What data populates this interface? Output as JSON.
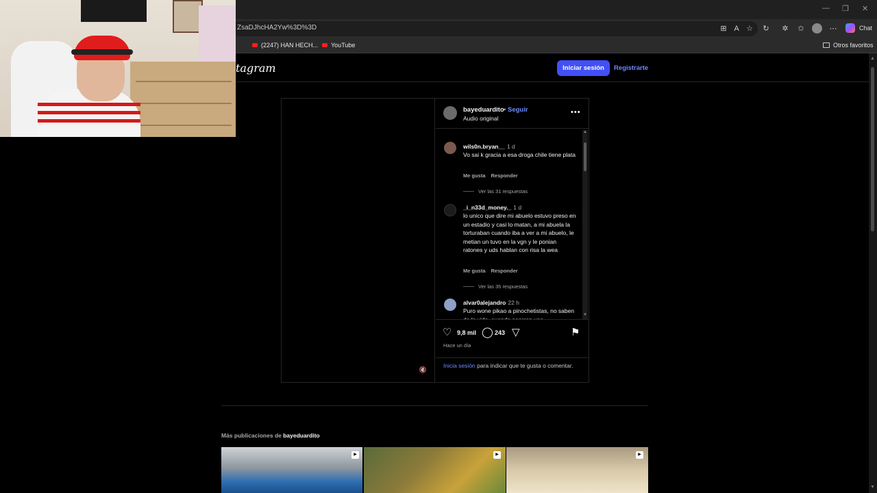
{
  "browser": {
    "url": "ZsaDJhcHA2Yw%3D%3D",
    "chat_label": "Chat",
    "bookmarks": [
      {
        "label": "(2247) HAN HECH..."
      },
      {
        "label": "YouTube"
      }
    ],
    "favorites_label": "Otros favoritos"
  },
  "header": {
    "logo": "tagram",
    "login_button": "Iniciar sesión",
    "register_link": "Registrarte"
  },
  "post": {
    "username": "bayeduardito",
    "separator": "•",
    "follow": "Seguir",
    "audio": "Audio original",
    "comments": [
      {
        "user": "wils0n.bryan__",
        "time": "1 d",
        "text": "Vo sai k gracia a esa droga chile tiene plata",
        "like": "Me gusta",
        "reply": "Responder",
        "replies": "Ver las 31 respuestas"
      },
      {
        "user": "_i_n33d_money._",
        "time": "1 d",
        "text": "lo unico que dire mi abuelo estuvo preso en un estadio y casi lo matan, a mi abuela la torturaban cuando iba a ver a mi abuelo, le metian un tuvo en la vgn y le ponian ratones y uds hablan con risa la wea",
        "like": "Me gusta",
        "reply": "Responder",
        "replies": "Ver las 35 respuestas"
      },
      {
        "user": "alvar0alejandro",
        "time": "22 h",
        "text": "Puro wone pikao a pinochetistas, no saben de la vida, cuando agarren una"
      }
    ],
    "likes": "9,8 mil",
    "comment_count": "243",
    "posted": "Hace un día",
    "login_link": "Inicia sesión",
    "login_rest": " para indicar que te gusta o comentar."
  },
  "more_posts": {
    "label": "Más publicaciones de ",
    "user": "bayeduardito"
  },
  "icons": [
    "heart-icon",
    "comment-icon",
    "share-icon",
    "bookmark-icon",
    "more-options-icon",
    "mute-icon",
    "reel-icon"
  ],
  "colors": {
    "accent": "#4150f7",
    "link": "#6e89ff",
    "background": "#000000"
  }
}
